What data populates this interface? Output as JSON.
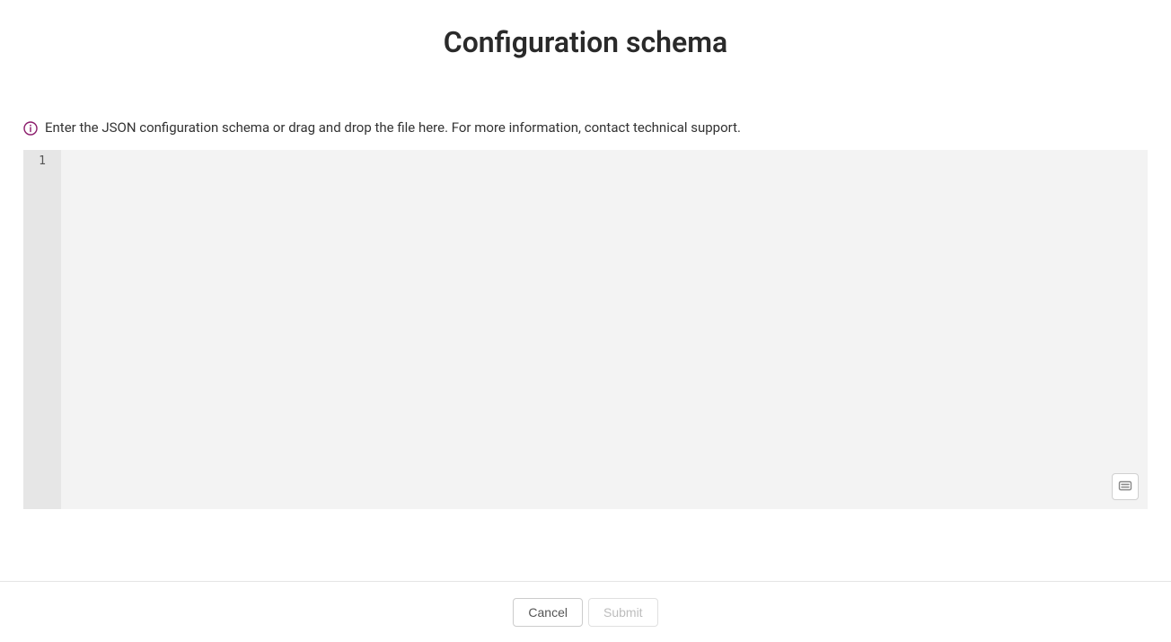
{
  "header": {
    "title": "Configuration schema"
  },
  "info": {
    "text": "Enter the JSON configuration schema or drag and drop the file here. For more information, contact technical support."
  },
  "editor": {
    "line_numbers": [
      "1"
    ],
    "content": ""
  },
  "footer": {
    "cancel_label": "Cancel",
    "submit_label": "Submit",
    "submit_disabled": true
  }
}
